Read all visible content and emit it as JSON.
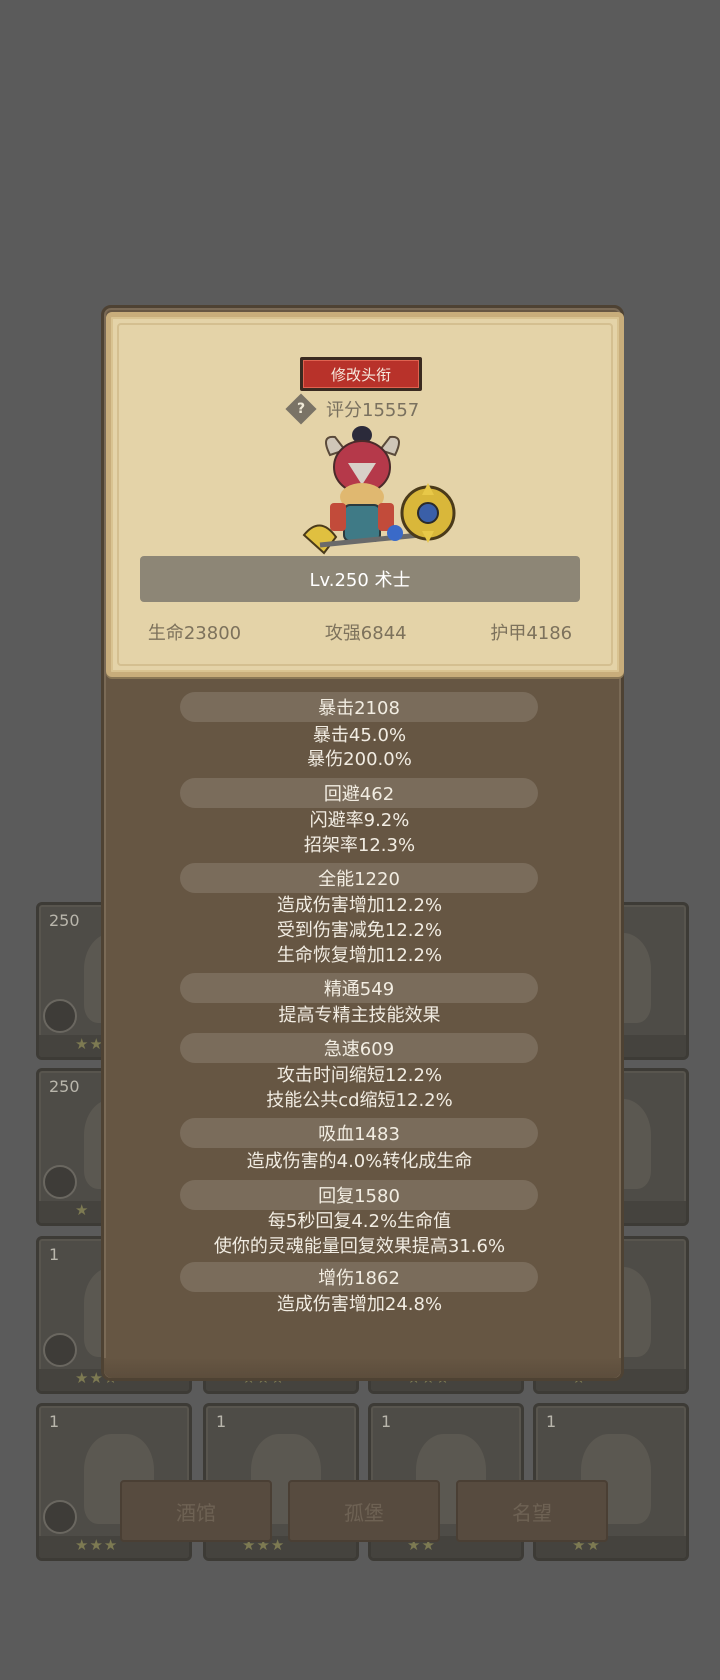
{
  "grid": {
    "rows": [
      [
        {
          "level": "250",
          "stars": "★★"
        },
        {
          "level": "",
          "stars": ""
        },
        {
          "level": "",
          "stars": ""
        },
        {
          "level": "",
          "stars": "★"
        }
      ],
      [
        {
          "level": "250",
          "stars": "★"
        },
        {
          "level": "",
          "stars": ""
        },
        {
          "level": "",
          "stars": ""
        },
        {
          "level": "",
          "stars": "★"
        }
      ],
      [
        {
          "level": "1",
          "stars": "★★★"
        },
        {
          "level": "",
          "stars": "★★★"
        },
        {
          "level": "",
          "stars": "★★★"
        },
        {
          "level": "",
          "stars": "★"
        }
      ],
      [
        {
          "level": "1",
          "stars": "★★★"
        },
        {
          "level": "1",
          "stars": "★★★"
        },
        {
          "level": "1",
          "stars": "★★"
        },
        {
          "level": "1",
          "stars": "★★"
        }
      ]
    ],
    "tabs": [
      "酒馆",
      "孤堡",
      "名望"
    ]
  },
  "panel": {
    "rename_button": "修改头衔",
    "help_icon": "?",
    "score": "评分15557",
    "hero_name": "Lv.250 术士",
    "base_stats": [
      "生命23800",
      "攻强6844",
      "护甲4186"
    ],
    "stats": [
      {
        "title": "暴击2108",
        "lines": [
          "暴击45.0%",
          "暴伤200.0%"
        ]
      },
      {
        "title": "回避462",
        "lines": [
          "闪避率9.2%",
          "招架率12.3%"
        ]
      },
      {
        "title": "全能1220",
        "lines": [
          "造成伤害增加12.2%",
          "受到伤害减免12.2%",
          "生命恢复增加12.2%"
        ]
      },
      {
        "title": "精通549",
        "lines": [
          "提高专精主技能效果"
        ]
      },
      {
        "title": "急速609",
        "lines": [
          "攻击时间缩短12.2%",
          "技能公共cd缩短12.2%"
        ]
      },
      {
        "title": "吸血1483",
        "lines": [
          "造成伤害的4.0%转化成生命"
        ]
      },
      {
        "title": "回复1580",
        "lines": [
          "每5秒回复4.2%生命值",
          "使你的灵魂能量回复效果提高31.6%"
        ]
      },
      {
        "title": "增伤1862",
        "lines": [
          "造成伤害增加24.8%"
        ]
      }
    ]
  },
  "colors": {
    "overlay_bg": "#5b5b5b",
    "panel_bg": "#665643",
    "parchment": "#e4d3a8",
    "rename_red": "#b8322a",
    "stat_pill": "#7a6c5b"
  }
}
